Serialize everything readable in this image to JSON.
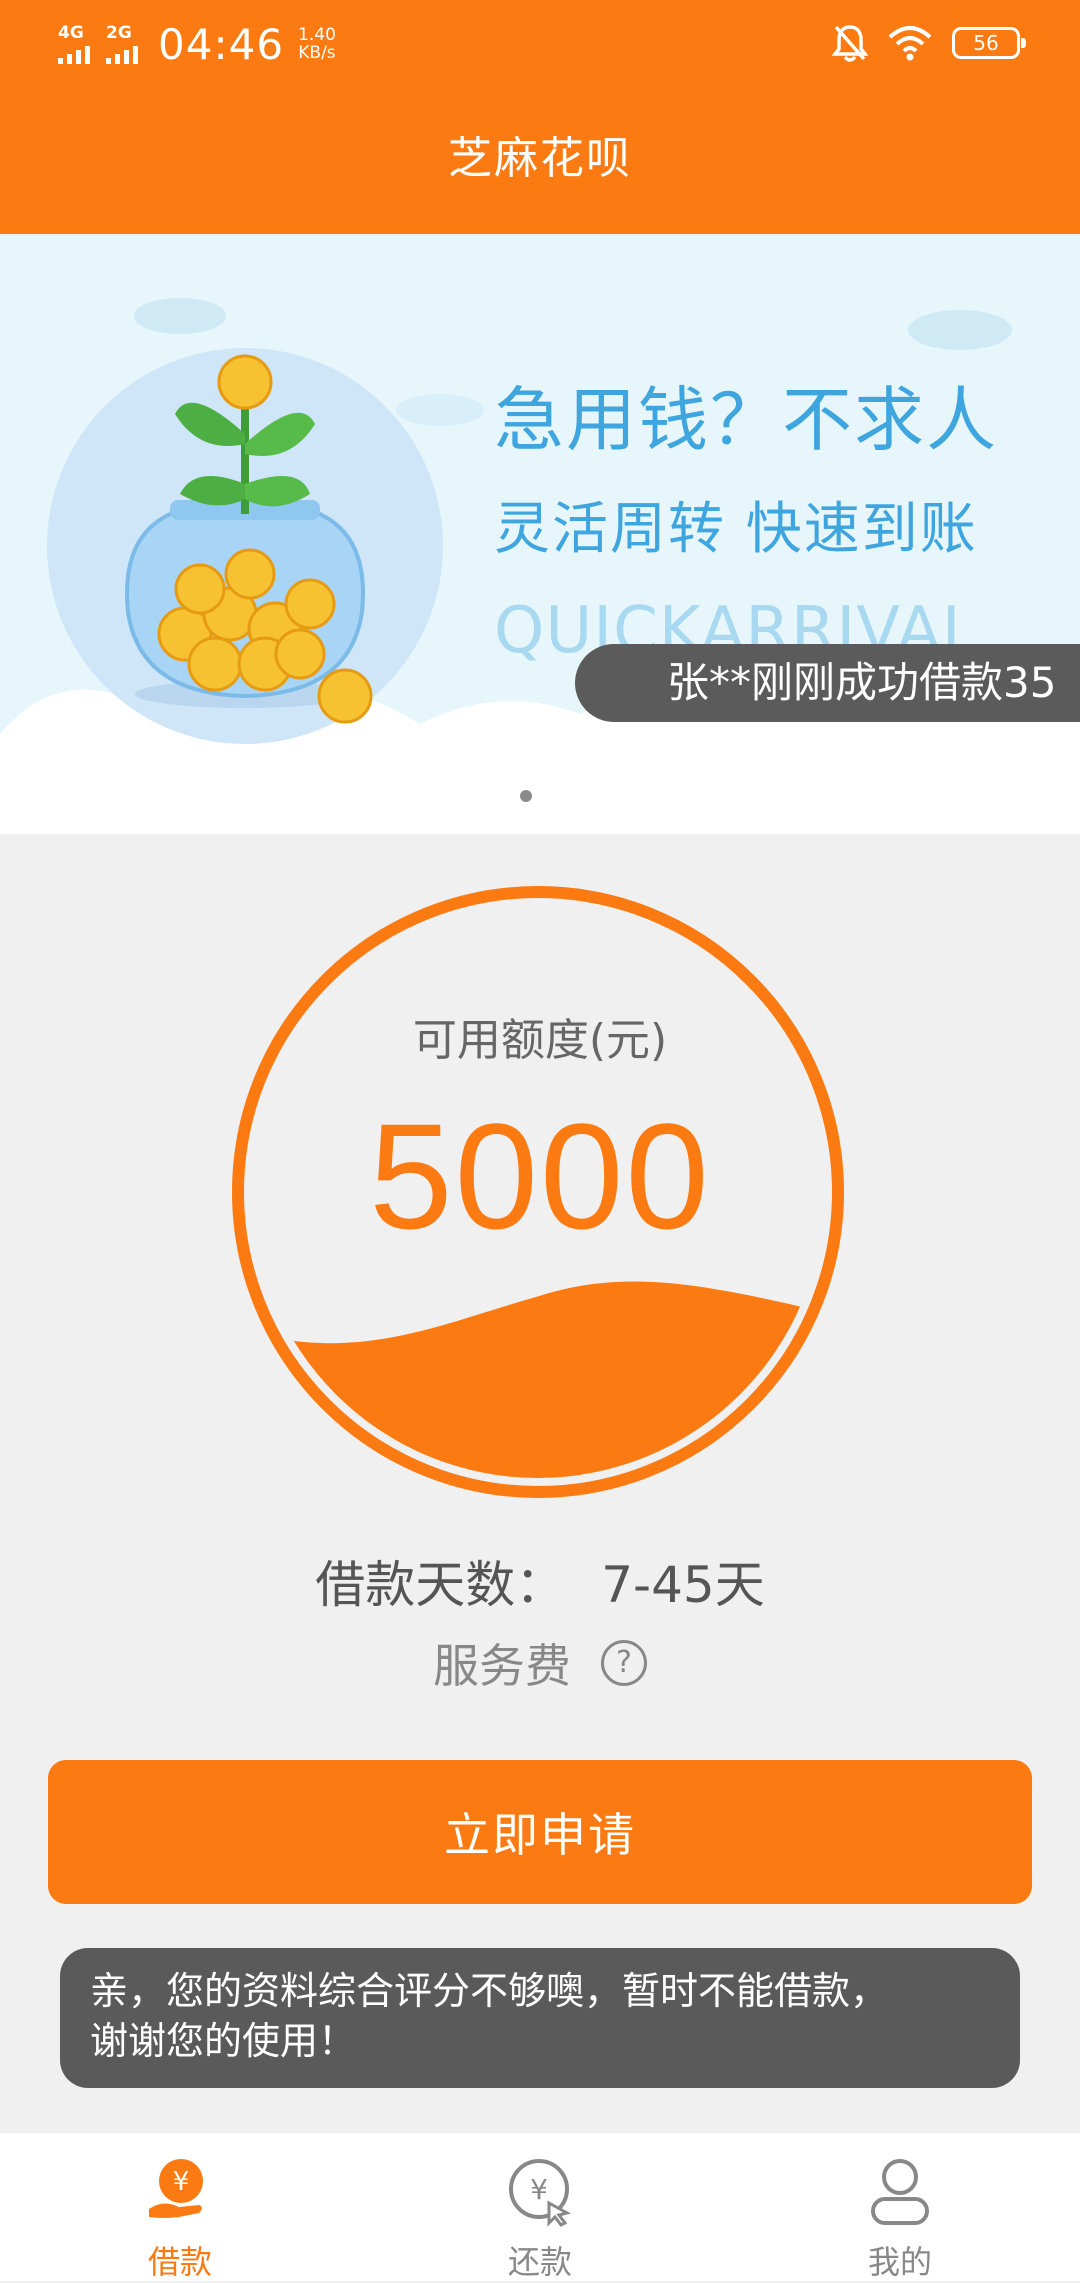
{
  "status_bar": {
    "network_1": "4G",
    "network_2": "2G",
    "time": "04:46",
    "speed_value": "1.40",
    "speed_unit": "KB/s",
    "battery": "56",
    "icons": [
      "bell-off-icon",
      "wifi-icon",
      "battery-icon"
    ]
  },
  "header": {
    "title": "芝麻花呗"
  },
  "banner": {
    "line1": "急用钱？不求人",
    "line2": "灵活周转  快速到账",
    "line3": "QUICKARRIVAL",
    "page_count": 2,
    "active_page": 1,
    "ticker": "张**刚刚成功借款35"
  },
  "credit": {
    "label": "可用额度(元)",
    "amount": "5000",
    "fill_level": 0.3,
    "accent_color": "#fb7a12"
  },
  "loan": {
    "days_label": "借款天数：",
    "days_value": "7-45天",
    "fee_label": "服务费",
    "fee_help": "?"
  },
  "apply_button": "立即申请",
  "toast": {
    "line1": "亲，您的资料综合评分不够噢，暂时不能借款，",
    "line2": "谢谢您的使用！"
  },
  "tabs": [
    {
      "label": "借款",
      "icon": "yen-hand-icon",
      "active": true
    },
    {
      "label": "还款",
      "icon": "yen-cursor-icon",
      "active": false
    },
    {
      "label": "我的",
      "icon": "user-icon",
      "active": false
    }
  ]
}
